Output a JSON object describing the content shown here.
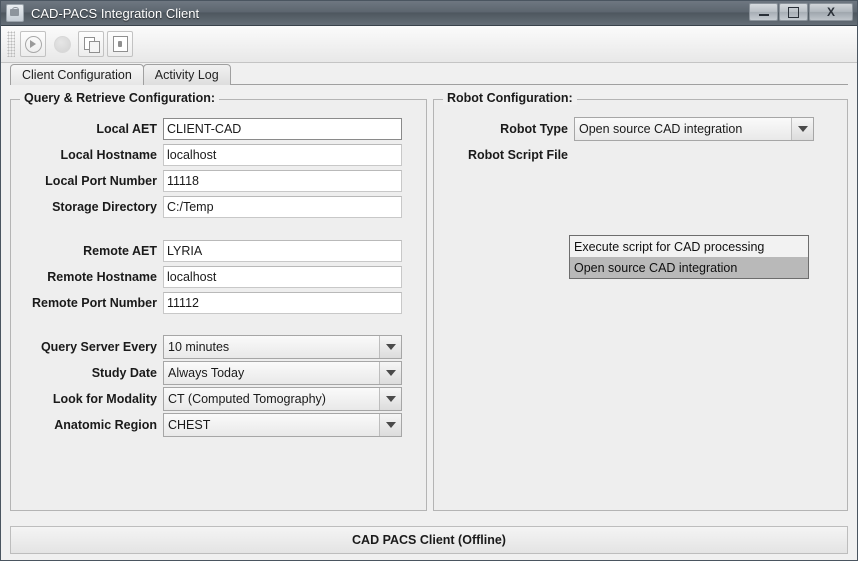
{
  "window": {
    "title": "CAD-PACS Integration Client",
    "icon": "app-icon",
    "controls": {
      "minimize": "minimize",
      "maximize": "maximize",
      "close": "X"
    }
  },
  "toolbar": {
    "buttons": [
      {
        "name": "start-button",
        "icon": "play-icon",
        "enabled": true
      },
      {
        "name": "stop-button",
        "icon": "stop-icon",
        "enabled": false
      },
      {
        "name": "copy-document-button",
        "icon": "document-copy-icon",
        "enabled": true
      },
      {
        "name": "lock-button",
        "icon": "lock-icon",
        "enabled": true
      }
    ]
  },
  "tabs": [
    {
      "label": "Client Configuration",
      "active": true
    },
    {
      "label": "Activity Log",
      "active": false
    }
  ],
  "left_panel": {
    "title": "Query & Retrieve Configuration:",
    "fields": [
      {
        "label": "Local AET",
        "value": "CLIENT-CAD",
        "type": "text",
        "focused": true
      },
      {
        "label": "Local Hostname",
        "value": "localhost",
        "type": "text",
        "focused": false
      },
      {
        "label": "Local Port Number",
        "value": "11118",
        "type": "text",
        "focused": false
      },
      {
        "label": "Storage Directory",
        "value": "C:/Temp",
        "type": "text",
        "focused": false
      },
      {
        "label": "Remote AET",
        "value": "LYRIA",
        "type": "text",
        "focused": false
      },
      {
        "label": "Remote Hostname",
        "value": "localhost",
        "type": "text",
        "focused": false
      },
      {
        "label": "Remote Port Number",
        "value": "11112",
        "type": "text",
        "focused": false
      },
      {
        "label": "Query Server Every",
        "value": "10 minutes",
        "type": "combo"
      },
      {
        "label": "Study Date",
        "value": "Always Today",
        "type": "combo"
      },
      {
        "label": "Look for Modality",
        "value": "CT (Computed Tomography)",
        "type": "combo"
      },
      {
        "label": "Anatomic Region",
        "value": "CHEST",
        "type": "combo"
      }
    ]
  },
  "right_panel": {
    "title": "Robot Configuration:",
    "robot_type": {
      "label": "Robot Type",
      "value": "Open source CAD integration",
      "open": true,
      "options": [
        {
          "label": "Execute script for CAD processing",
          "selected": false
        },
        {
          "label": "Open source CAD integration",
          "selected": true
        }
      ]
    },
    "robot_script_file": {
      "label": "Robot Script File",
      "value": ""
    }
  },
  "statusbar": {
    "text": "CAD PACS Client (Offline)"
  },
  "colors": {
    "window_background": "#f0f0f0",
    "panel_background": "#eeeeee",
    "titlebar": "#5d666f",
    "popup_selected": "#b9b9b9",
    "field_background": "#ffffff"
  }
}
